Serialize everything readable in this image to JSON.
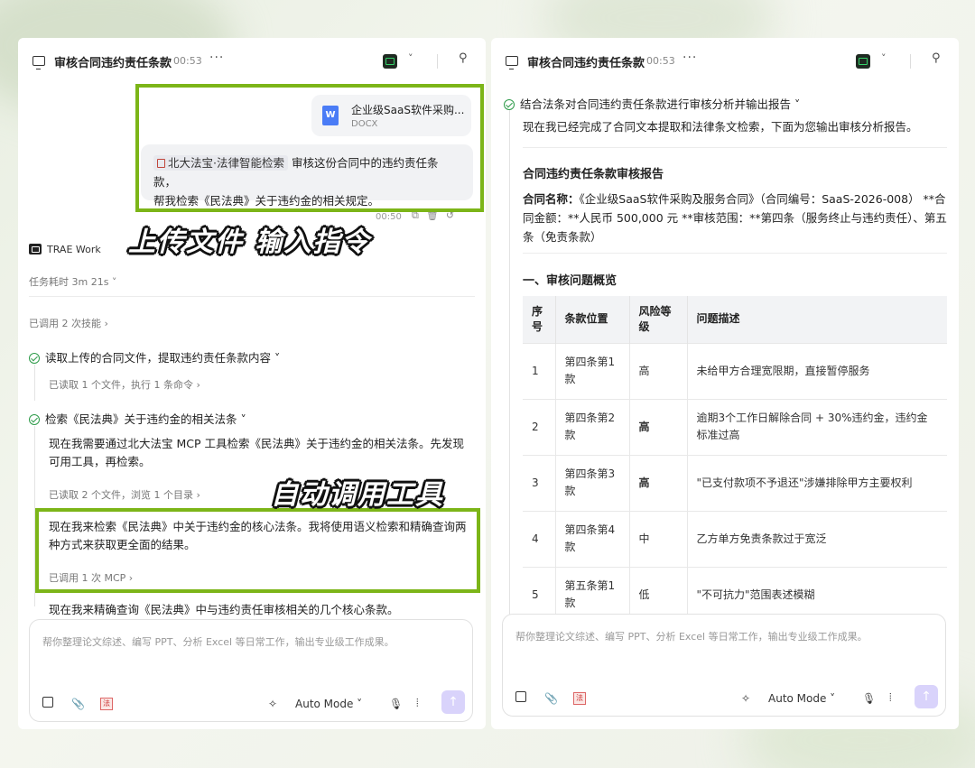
{
  "left": {
    "header": {
      "title": "审核合同违约责任条款",
      "time": "00:53",
      "more": "···"
    },
    "file": {
      "name": "企业级SaaS软件采购...",
      "type": "DOCX",
      "badge": "W"
    },
    "user_msg": {
      "tag": "北大法宝·法律智能检索",
      "text_line1": " 审核这份合同中的违约责任条款，",
      "text_line2": "帮我检索《民法典》关于违约金的相关规定。",
      "time": "00:50"
    },
    "overlay1": "上传文件 输入指令",
    "overlay2": "自动调用工具",
    "agent": "TRAE Work",
    "duration": "任务耗时 3m 21s ˅",
    "skills": "已调用 2 次技能  ›",
    "step1": {
      "title": "读取上传的合同文件，提取违约责任条款内容  ˅",
      "sub": "已读取 1 个文件，执行 1 条命令  ›"
    },
    "step2": {
      "title": "检索《民法典》关于违约金的相关法条  ˅",
      "para_line1": "现在我需要通过北大法宝 MCP 工具检索《民法典》关于违约金的相关法条。先发现",
      "para_line2": "可用工具，再检索。",
      "sub": "已读取 2 个文件，浏览 1 个目录  ›"
    },
    "block3": {
      "line1": "现在我来检索《民法典》中关于违约金的核心法条。我将使用语义检索和精确查询两",
      "line2": "种方式来获取更全面的结果。",
      "sub": "已调用 1 次 MCP  ›"
    },
    "para4": "现在我来精确查询《民法典》中与违约责任审核相关的几个核心条款。",
    "input": {
      "placeholder": "帮你整理论文综述、编写 PPT、分析 Excel 等日常工作，输出专业级工作成果。",
      "mode": "Auto Mode ˅"
    }
  },
  "right": {
    "header": {
      "title": "审核合同违约责任条款",
      "time": "00:53",
      "more": "···"
    },
    "step": "结合法条对合同违约责任条款进行审核分析并输出报告  ˅",
    "intro": "现在我已经完成了合同文本提取和法律条文检索，下面为您输出审核分析报告。",
    "report_title": "合同违约责任条款审核报告",
    "contract_label": "合同名称：",
    "contract_line1": "《企业级SaaS软件采购及服务合同》（合同编号：SaaS-2026-008） **合",
    "contract_line2": "同金额：**人民币 500,000 元 **审核范围：**第四条（服务终止与违约责任）、第五",
    "contract_line3": "条（免责条款）",
    "section1": "一、审核问题概览",
    "table": {
      "headers": [
        "序\n号",
        "条款位置",
        "风险等\n级",
        "问题描述"
      ],
      "rows": [
        [
          "1",
          "第四条第1款",
          "高",
          "未给甲方合理宽限期，直接暂停服务"
        ],
        [
          "2",
          "第四条第2款",
          "高",
          "逾期3个工作日解除合同 + 30%违约金，违约金标准过高"
        ],
        [
          "3",
          "第四条第3款",
          "高",
          "\"已支付款项不予退还\"涉嫌排除甲方主要权利"
        ],
        [
          "4",
          "第四条第4款",
          "中",
          "乙方单方免责条款过于宽泛"
        ],
        [
          "5",
          "第五条第1款",
          "低",
          "\"不可抗力\"范围表述模糊"
        ]
      ]
    },
    "input": {
      "placeholder": "帮你整理论文综述、编写 PPT、分析 Excel 等日常工作，输出专业级工作成果。",
      "mode": "Auto Mode ˅"
    }
  },
  "colors": {
    "highlight": "#7cb518",
    "send": "#d9d3fb",
    "check": "#2e9b4a"
  }
}
